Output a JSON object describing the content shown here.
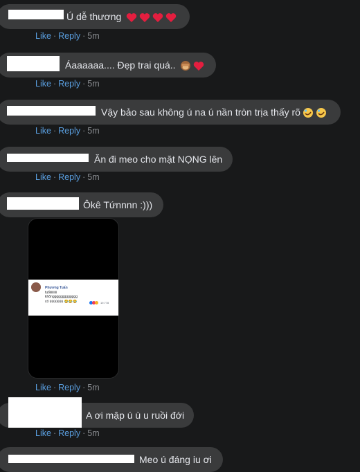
{
  "actions": {
    "like": "Like",
    "reply": "Reply",
    "separator": "·"
  },
  "comments": [
    {
      "text": "Ú dễ thương",
      "time": "5m",
      "emojis": [
        "heart",
        "heart",
        "heart",
        "heart"
      ]
    },
    {
      "text": "Áaaaaaa.... Đẹp trai quá..",
      "time": "5m",
      "emojis": [
        "see-no-evil-monkey",
        "heart"
      ]
    },
    {
      "text": "Vậy bảo sau không ú na ú nần tròn trịa thấy rõ",
      "time": "5m",
      "emojis": [
        "rofl",
        "rofl"
      ]
    },
    {
      "text": "Ăn đi meo cho mặt NỌNG lên",
      "time": "5m",
      "emojis": []
    },
    {
      "text": "Ôkê Tứnnnn :)))",
      "time": "5m",
      "emojis": [],
      "attachment": {
        "name": "Phương Tuấn",
        "line1": "tuổiiiiiiiii",
        "line2": "khônggggggggggggg",
        "line3": "có úúúúúúú 😂😂😂",
        "count": "19.778"
      }
    },
    {
      "text": "A ơi mập ú ù u ruồi đới",
      "time": "5m",
      "emojis": []
    },
    {
      "text": "Meo ú đáng iu ơi",
      "time": "",
      "emojis": []
    }
  ],
  "colors": {
    "background": "#18191a",
    "bubble": "#3a3b3c",
    "link": "#5a9fe0",
    "heart": "#e41e3f"
  }
}
